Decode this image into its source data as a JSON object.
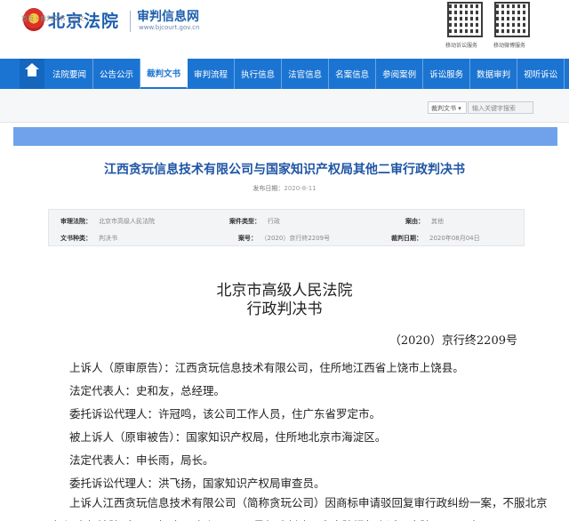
{
  "header": {
    "site_name": "北京法院",
    "sub_name": "审判信息网",
    "sub_url": "www.bjcourt.gov.cn",
    "qr_codes": [
      {
        "label": "移动诉讼服务"
      },
      {
        "label": "移动微博服务"
      }
    ]
  },
  "nav": {
    "items": [
      {
        "label": "法院要闻"
      },
      {
        "label": "公告公示"
      },
      {
        "label": "裁判文书",
        "active": true
      },
      {
        "label": "审判流程"
      },
      {
        "label": "执行信息"
      },
      {
        "label": "法官信息"
      },
      {
        "label": "名案信息"
      },
      {
        "label": "参阅案例"
      },
      {
        "label": "诉讼服务"
      },
      {
        "label": "数据审判"
      },
      {
        "label": "视听诉讼"
      }
    ]
  },
  "breadcrumb": "首页 › 裁判文书 › 正文",
  "search": {
    "select_value": "裁判文书 ▾",
    "placeholder": "输入关键字搜索"
  },
  "document": {
    "title": "江西贪玩信息技术有限公司与国家知识产权局其他二审行政判决书",
    "publish_label": "发布日期：",
    "publish_date": "2020-8-11",
    "meta": {
      "court_label": "审理法院：",
      "court": "北京市高级人民法院",
      "case_type_label": "案件类型：",
      "case_type": "行政",
      "cause_label": "案由：",
      "cause": "其他",
      "doc_type_label": "文书种类：",
      "doc_type": "判决书",
      "case_no_label": "案号：",
      "case_no": "（2020）京行终2209号",
      "judge_date_label": "裁判日期：",
      "judge_date": "2020年08月04日"
    },
    "court_name": "北京市高级人民法院",
    "judgment_type": "行政判决书",
    "case_number": "（2020）京行终2209号",
    "paragraphs": [
      "上诉人（原审原告）：江西贪玩信息技术有限公司，住所地江西省上饶市上饶县。",
      "法定代表人：史和友，总经理。",
      "委托诉讼代理人：许冠鸣，该公司工作人员，住广东省罗定市。",
      "被上诉人（原审被告）：国家知识产权局，住所地北京市海淀区。",
      "法定代表人：申长雨，局长。",
      "委托诉讼代理人：洪飞扬，国家知识产权局审查员。"
    ],
    "last_paragraph": "上诉人江西贪玩信息技术有限公司（简称贪玩公司）因商标申请驳回复审行政纠纷一案，不服北京知识产权法院（2019）京73行初11068号行政判决，向本院提起上诉。本院于2020年5月11"
  }
}
